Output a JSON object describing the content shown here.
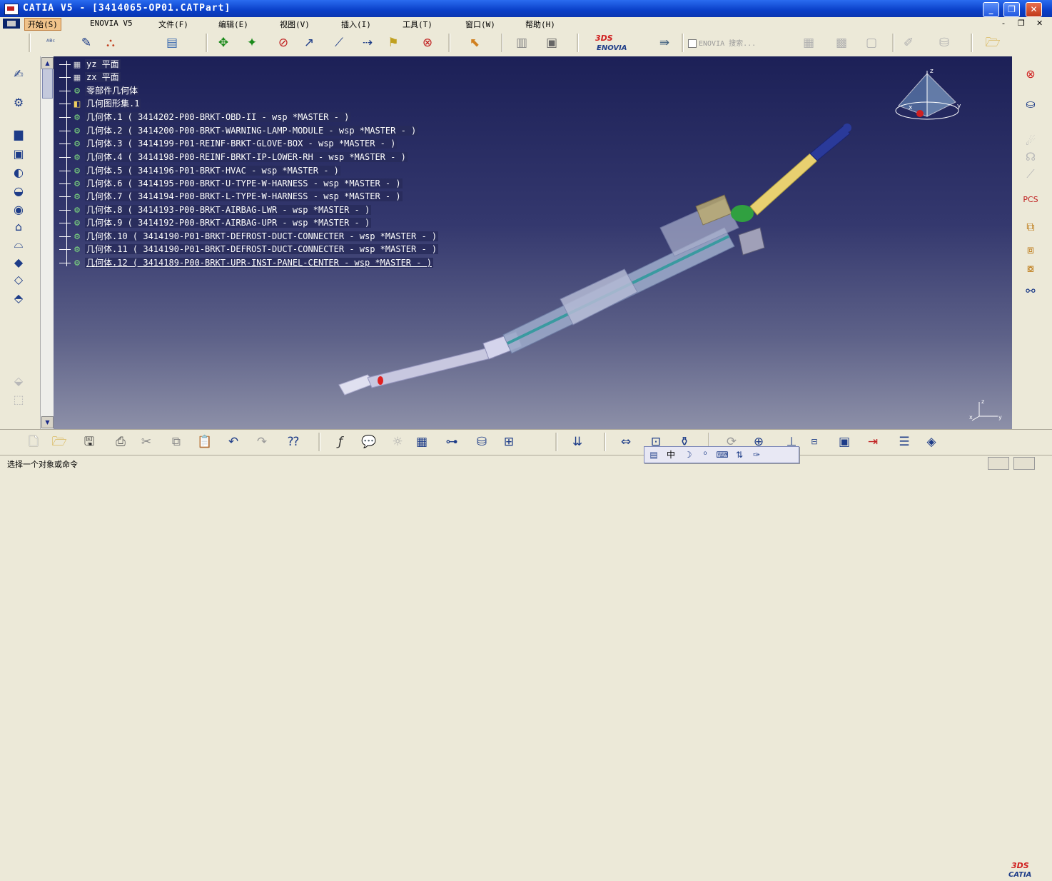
{
  "window": {
    "title": "CATIA V5 - [3414065-OP01.CATPart]",
    "buttons": {
      "minimize": "_",
      "restore": "❐",
      "close": "✕"
    }
  },
  "menu": {
    "items": [
      "开始(S)",
      "ENOVIA V5",
      "文件(F)",
      "编辑(E)",
      "视图(V)",
      "插入(I)",
      "工具(T)",
      "窗口(W)",
      "帮助(H)"
    ],
    "mdi_buttons": [
      "-",
      "❐",
      "✕"
    ]
  },
  "toolbar": {
    "enovia_search": "ENOVIA 搜索..."
  },
  "tree": {
    "nodes": [
      {
        "icon": "plane-icon",
        "label": "yz 平面"
      },
      {
        "icon": "plane-icon",
        "label": "zx 平面"
      },
      {
        "icon": "body-icon",
        "label": "零部件几何体"
      },
      {
        "icon": "geoset-icon",
        "label": "几何图形集.1"
      },
      {
        "icon": "body-icon",
        "label": "几何体.1 ( 3414202-P00-BRKT-OBD-II - wsp *MASTER -  )"
      },
      {
        "icon": "body-icon",
        "label": "几何体.2 ( 3414200-P00-BRKT-WARNING-LAMP-MODULE - wsp *MASTER -  )"
      },
      {
        "icon": "body-icon",
        "label": "几何体.3 ( 3414199-P01-REINF-BRKT-GLOVE-BOX - wsp *MASTER -  )"
      },
      {
        "icon": "body-icon",
        "label": "几何体.4 ( 3414198-P00-REINF-BRKT-IP-LOWER-RH - wsp *MASTER -  )"
      },
      {
        "icon": "body-icon",
        "label": "几何体.5 ( 3414196-P01-BRKT-HVAC - wsp *MASTER -  )"
      },
      {
        "icon": "body-icon",
        "label": "几何体.6 ( 3414195-P00-BRKT-U-TYPE-W-HARNESS - wsp *MASTER -  )"
      },
      {
        "icon": "body-icon",
        "label": "几何体.7 ( 3414194-P00-BRKT-L-TYPE-W-HARNESS - wsp *MASTER -  )"
      },
      {
        "icon": "body-icon",
        "label": "几何体.8 ( 3414193-P00-BRKT-AIRBAG-LWR - wsp *MASTER -  )"
      },
      {
        "icon": "body-icon",
        "label": "几何体.9 ( 3414192-P00-BRKT-AIRBAG-UPR - wsp *MASTER -  )"
      },
      {
        "icon": "body-icon",
        "label": "几何体.10 ( 3414190-P01-BRKT-DEFROST-DUCT-CONNECTER - wsp *MASTER -  )"
      },
      {
        "icon": "body-icon",
        "label": "几何体.11 ( 3414190-P01-BRKT-DEFROST-DUCT-CONNECTER - wsp *MASTER -  )"
      },
      {
        "icon": "body-icon",
        "label": "几何体.12 ( 3414189-P00-BRKT-UPR-INST-PANEL-CENTER - wsp *MASTER -  )"
      }
    ]
  },
  "compass": {
    "x": "x",
    "y": "y",
    "z": "z"
  },
  "mini_axis": {
    "x": "x",
    "y": "y",
    "z": "z"
  },
  "float_toolbar": {
    "chinese_mode": "中"
  },
  "logo": {
    "brand": "CATIA",
    "mark": "3DS",
    "enovia": "ENOVIA"
  },
  "status": {
    "message": "选择一个对象或命令"
  },
  "colors": {
    "accent": "#0a3fc8",
    "viewport_top": "#1c2057",
    "viewport_bottom": "#8d90a8"
  }
}
